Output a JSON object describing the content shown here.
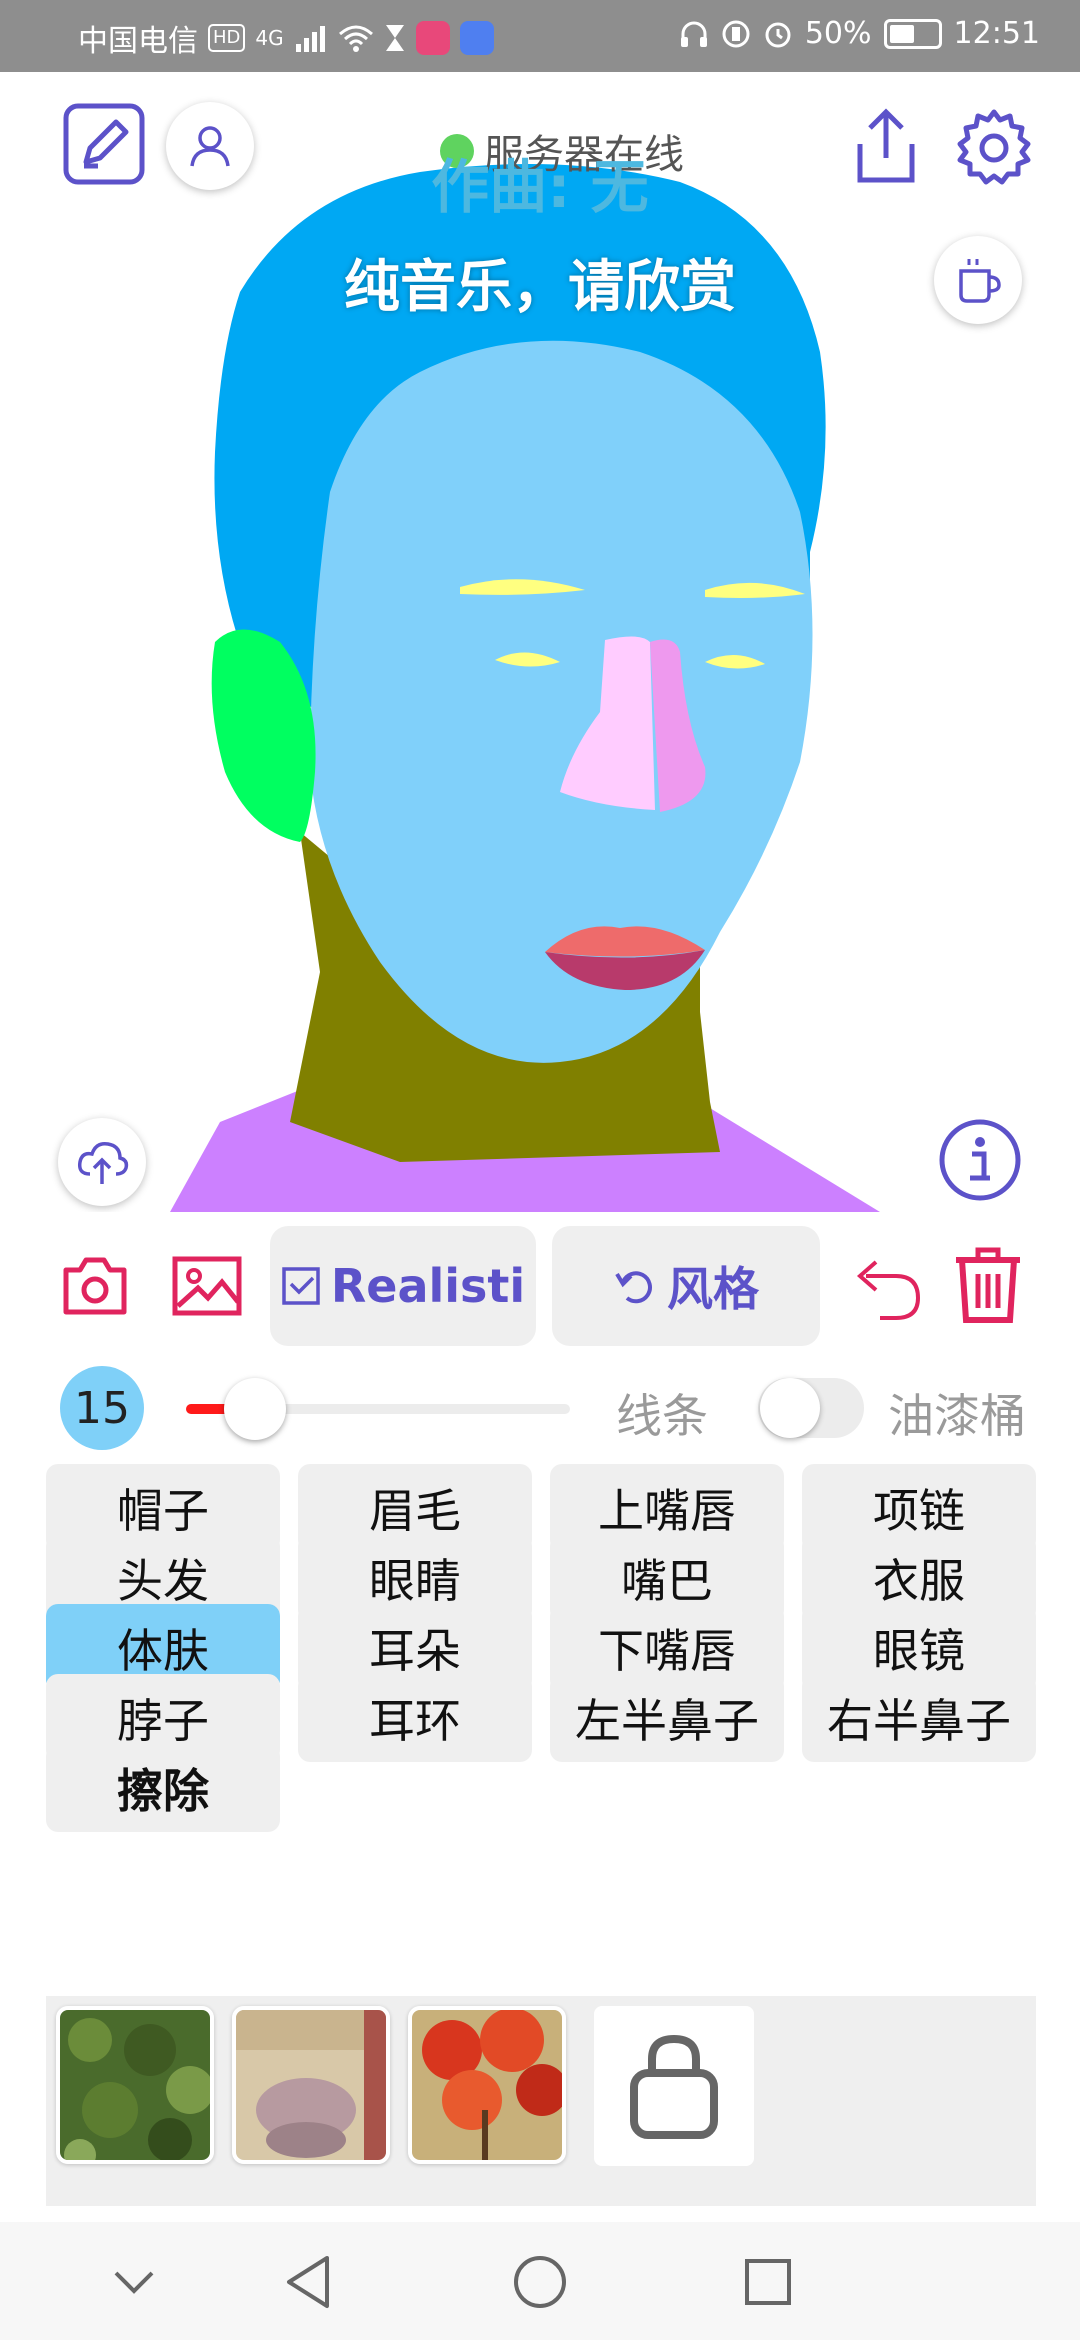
{
  "status_bar": {
    "carrier": "中国电信",
    "hd_badge": "HD",
    "network": "4G",
    "battery_percent": "50%",
    "time": "12:51"
  },
  "header": {
    "server_status": "服务器在线",
    "composer_text": "作曲: 无",
    "music_note": "纯音乐，请欣赏"
  },
  "toolbar": {
    "style_toggle_label": "Realisti",
    "style_button_label": "风格"
  },
  "brush": {
    "size": "15",
    "size_fraction": 0.18,
    "line_label": "线条",
    "bucket_label": "油漆桶"
  },
  "labels": [
    {
      "text": "帽子"
    },
    {
      "text": "眉毛"
    },
    {
      "text": "上嘴唇"
    },
    {
      "text": "项链"
    },
    {
      "text": "头发"
    },
    {
      "text": "眼睛"
    },
    {
      "text": "嘴巴"
    },
    {
      "text": "衣服"
    },
    {
      "text": "体肤"
    },
    {
      "text": "耳朵"
    },
    {
      "text": "下嘴唇"
    },
    {
      "text": "眼镜"
    },
    {
      "text": "脖子"
    },
    {
      "text": "耳环"
    },
    {
      "text": "左半鼻子"
    },
    {
      "text": "右半鼻子"
    },
    {
      "text": "擦除"
    }
  ],
  "selected_label": "体肤",
  "colors": {
    "accent": "#5c52c9",
    "danger": "#e0245e",
    "selected_chip": "#7fd0f8",
    "hair": "#00a8f3",
    "skin": "#80d0fa",
    "neck": "#808000",
    "clothes": "#cc80ff",
    "ear": "#00ff60"
  },
  "styles": [
    {
      "name": "green-foliage"
    },
    {
      "name": "beige-texture"
    },
    {
      "name": "red-flowers"
    },
    {
      "name": "locked"
    }
  ]
}
